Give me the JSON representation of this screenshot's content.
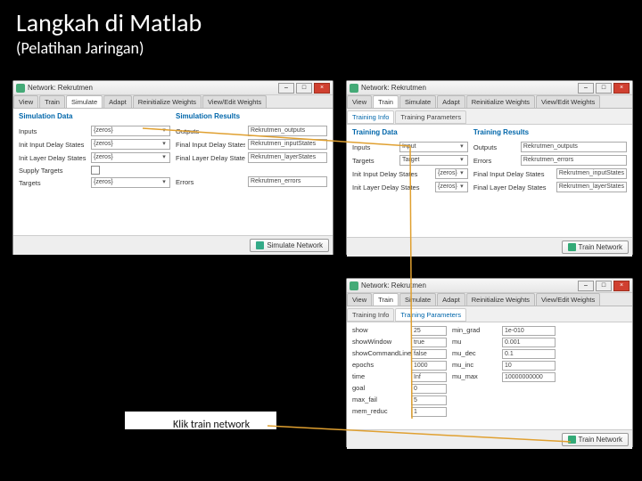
{
  "slide": {
    "title": "Langkah di Matlab",
    "subtitle": "(Pelatihan Jaringan)",
    "caption_klik": "Klik train network"
  },
  "win1": {
    "title": "Network: Rekrutmen",
    "tabs": [
      "View",
      "Train",
      "Simulate",
      "Adapt",
      "Reinitialize Weights",
      "View/Edit Weights"
    ],
    "active_tab": "Simulate",
    "left_header": "Simulation Data",
    "right_header": "Simulation Results",
    "rows_left": [
      {
        "label": "Inputs",
        "value": "{zeros}",
        "dd": true
      },
      {
        "label": "Init Input Delay States",
        "value": "{zeros}",
        "dd": true
      },
      {
        "label": "Init Layer Delay States",
        "value": "{zeros}",
        "dd": true
      },
      {
        "label": "Supply Targets",
        "value": "",
        "dd": false
      },
      {
        "label": "Targets",
        "value": "{zeros}",
        "dd": true
      }
    ],
    "rows_right": [
      {
        "label": "Outputs",
        "value": "Rekrutmen_outputs"
      },
      {
        "label": "Final Input Delay States",
        "value": "Rekrutmen_inputStates"
      },
      {
        "label": "Final Layer Delay States",
        "value": "Rekrutmen_layerStates"
      },
      {
        "label": "Errors",
        "value": "Rekrutmen_errors"
      }
    ],
    "button": "Simulate Network"
  },
  "win2": {
    "title": "Network: Rekrutmen",
    "tabs": [
      "View",
      "Train",
      "Simulate",
      "Adapt",
      "Reinitialize Weights",
      "View/Edit Weights"
    ],
    "active_tab": "Train",
    "subtabs": [
      "Training Info",
      "Training Parameters"
    ],
    "active_subtab": "Training Info",
    "left_header": "Training Data",
    "right_header": "Training Results",
    "rows_left": [
      {
        "label": "Inputs",
        "value": "Input",
        "dd": true
      },
      {
        "label": "Targets",
        "value": "Target",
        "dd": true
      },
      {
        "label": "Init Input Delay States",
        "value": "{zeros}",
        "dd": true
      },
      {
        "label": "Init Layer Delay States",
        "value": "{zeros}",
        "dd": true
      }
    ],
    "rows_right": [
      {
        "label": "Outputs",
        "value": "Rekrutmen_outputs"
      },
      {
        "label": "Errors",
        "value": "Rekrutmen_errors"
      },
      {
        "label": "Final Input Delay States",
        "value": "Rekrutmen_inputStates"
      },
      {
        "label": "Final Layer Delay States",
        "value": "Rekrutmen_layerStates"
      }
    ],
    "button": "Train Network"
  },
  "win3": {
    "title": "Network: Rekrutmen",
    "tabs": [
      "View",
      "Train",
      "Simulate",
      "Adapt",
      "Reinitialize Weights",
      "View/Edit Weights"
    ],
    "active_tab": "Train",
    "subtabs": [
      "Training Info",
      "Training Parameters"
    ],
    "active_subtab": "Training Parameters",
    "params": [
      [
        "show",
        "25",
        "min_grad",
        "1e-010"
      ],
      [
        "showWindow",
        "true",
        "mu",
        "0.001"
      ],
      [
        "showCommandLine",
        "false",
        "mu_dec",
        "0.1"
      ],
      [
        "epochs",
        "1000",
        "mu_inc",
        "10"
      ],
      [
        "time",
        "Inf",
        "mu_max",
        "10000000000"
      ],
      [
        "goal",
        "0",
        "",
        ""
      ],
      [
        "max_fail",
        "5",
        "",
        ""
      ],
      [
        "mem_reduc",
        "1",
        "",
        ""
      ]
    ],
    "button": "Train Network"
  }
}
